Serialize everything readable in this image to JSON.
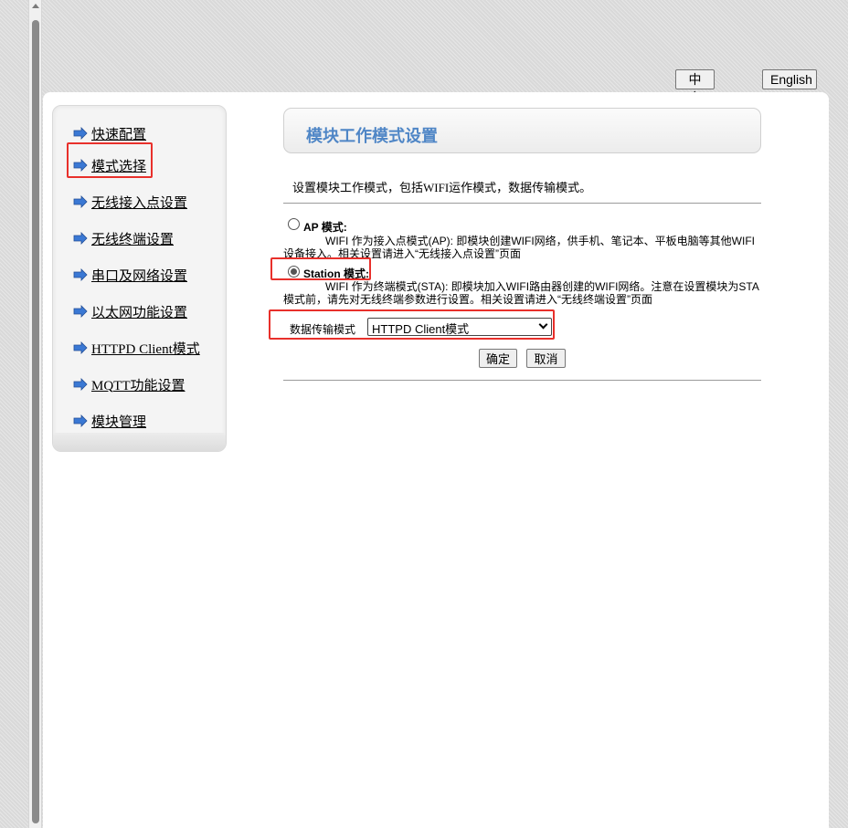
{
  "language": {
    "zh_label": "中文",
    "en_label": "English"
  },
  "sidebar": {
    "items": [
      {
        "label": "快速配置",
        "icon": "arrow-right-icon"
      },
      {
        "label": "模式选择",
        "icon": "arrow-right-icon"
      },
      {
        "label": "无线接入点设置",
        "icon": "arrow-right-icon"
      },
      {
        "label": "无线终端设置",
        "icon": "arrow-right-icon"
      },
      {
        "label": "串口及网络设置",
        "icon": "arrow-right-icon"
      },
      {
        "label": "以太网功能设置",
        "icon": "arrow-right-icon"
      },
      {
        "label": "HTTPD Client模式",
        "icon": "arrow-right-icon"
      },
      {
        "label": "MQTT功能设置",
        "icon": "arrow-right-icon"
      },
      {
        "label": "模块管理",
        "icon": "arrow-right-icon"
      }
    ]
  },
  "main": {
    "title": "模块工作模式设置",
    "description": "设置模块工作模式，包括WIFI运作模式，数据传输模式。",
    "ap_mode": {
      "label": "AP 模式:",
      "text": "WIFI 作为接入点模式(AP): 即模块创建WIFI网络，供手机、笔记本、平板电脑等其他WIFI设备接入。相关设置请进入“无线接入点设置”页面",
      "checked": false
    },
    "station_mode": {
      "label": "Station 模式:",
      "text": "WIFI 作为终端模式(STA): 即模块加入WIFI路由器创建的WIFI网络。注意在设置模块为STA模式前，请先对无线终端参数进行设置。相关设置请进入“无线终端设置”页面",
      "checked": true
    },
    "transfer_mode": {
      "label": "数据传输模式",
      "selected": "HTTPD Client模式"
    },
    "ok_label": "确定",
    "cancel_label": "取消"
  },
  "colors": {
    "title_blue": "#4f86c6",
    "annotation_red": "#e8302b",
    "arrow_blue": "#3a78d4"
  }
}
